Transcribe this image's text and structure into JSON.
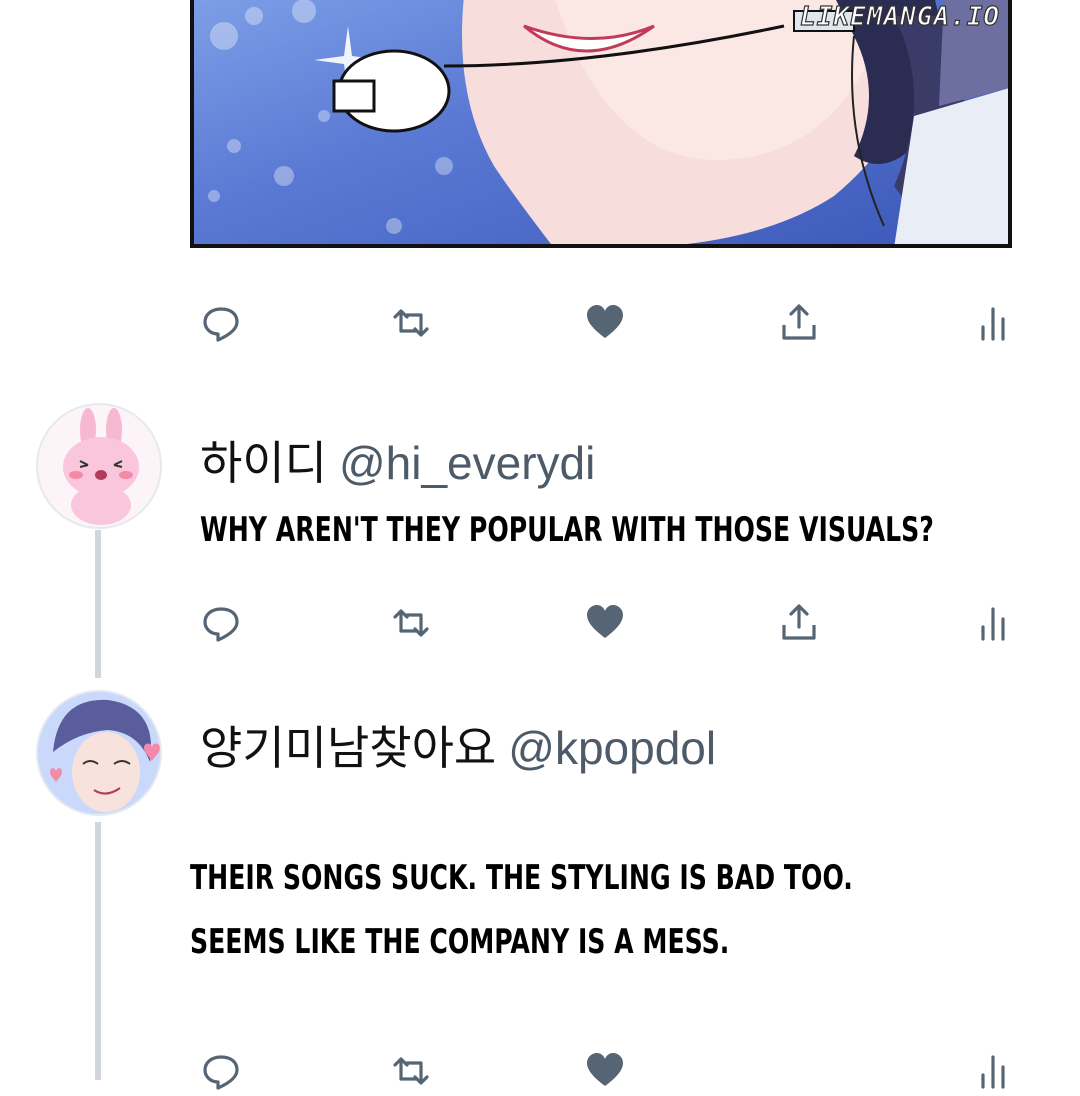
{
  "watermark": "LIKEMANGA.IO",
  "colors": {
    "icon": "#566573",
    "thread_line": "#cfd6de",
    "handle": "#4d5a68"
  },
  "tweet_actions": {
    "icons": [
      "reply-icon",
      "retweet-icon",
      "like-icon",
      "share-icon",
      "analytics-icon"
    ]
  },
  "replies": [
    {
      "display_name": "하이디",
      "handle": "@hi_everydi",
      "text_lines": [
        "WHY AREN'T THEY POPULAR WITH THOSE VISUALS?"
      ],
      "avatar": "pink-bunny-avatar"
    },
    {
      "display_name": "양기미남찾아요",
      "handle": "@kpopdol",
      "text_lines": [
        "THEIR SONGS SUCK. THE STYLING IS BAD TOO.",
        "SEEMS LIKE THE COMPANY IS A MESS."
      ],
      "avatar": "idol-fan-avatar"
    }
  ]
}
